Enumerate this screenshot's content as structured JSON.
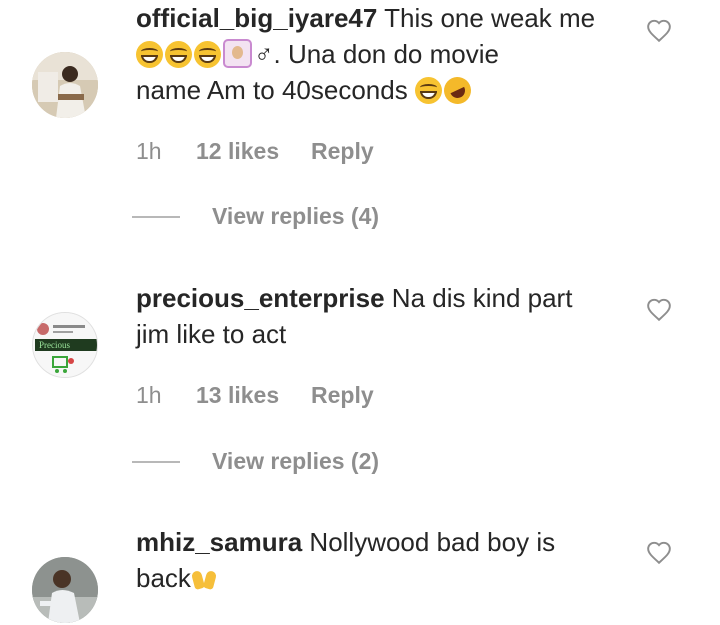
{
  "comments": [
    {
      "username": "official_big_iyare47",
      "text_line1": " This one weak me",
      "text_line2": ". Una don do movie",
      "text_line2_prefix": "♂",
      "text_line3": "name Am to 40seconds ",
      "time": "1h",
      "likes": "12 likes",
      "reply": "Reply",
      "view_replies": "View replies (4)"
    },
    {
      "username": "precious_enterprise",
      "text_line1": " Na dis kind part",
      "text_line2": "jim like to act",
      "avatar_text": "Precious",
      "time": "1h",
      "likes": "13 likes",
      "reply": "Reply",
      "view_replies": "View replies (2)"
    },
    {
      "username": "mhiz_samura",
      "text_line1": " Nollywood bad boy is",
      "text_line2": "back"
    }
  ],
  "icons": {
    "like": "heart-outline-icon",
    "emoji_laugh": "grinning-squinting-face-icon",
    "emoji_rofl": "rolling-on-floor-laughing-icon",
    "emoji_facepalm": "person-facepalming-icon",
    "emoji_hands": "raising-hands-icon"
  },
  "colors": {
    "text": "#262626",
    "secondary": "#8e8e8e",
    "divider": "#b8b8b8"
  }
}
